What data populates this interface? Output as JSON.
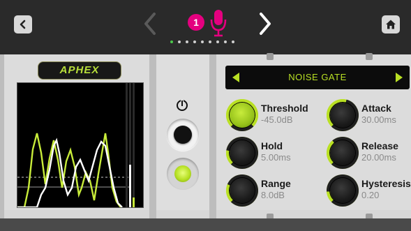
{
  "topbar": {
    "channel_number": "1",
    "page_dots": {
      "count": 9,
      "active_index": 0
    }
  },
  "brand": {
    "logo_text": "APHEX"
  },
  "module": {
    "type_name": "NOISE GATE",
    "bypass_on": false,
    "enable_led_on": true
  },
  "params": [
    {
      "label": "Threshold",
      "value": "-45.0dB",
      "lit": true,
      "level": 1.0
    },
    {
      "label": "Attack",
      "value": "30.00ms",
      "lit": false,
      "level": 0.55
    },
    {
      "label": "Hold",
      "value": "5.00ms",
      "lit": false,
      "level": 0.2
    },
    {
      "label": "Release",
      "value": "20.00ms",
      "lit": false,
      "level": 0.35
    },
    {
      "label": "Range",
      "value": "8.0dB",
      "lit": false,
      "level": 0.25
    },
    {
      "label": "Hysteresis",
      "value": "0.20",
      "lit": false,
      "level": 0.15
    }
  ],
  "colors": {
    "accent": "#b9e024",
    "channel_badge": "#e4007f",
    "signal_pre": "#c8ec3a",
    "signal_post": "#ffffff"
  },
  "meters": {
    "in_level": 0.34,
    "gate_level": 0.08
  }
}
